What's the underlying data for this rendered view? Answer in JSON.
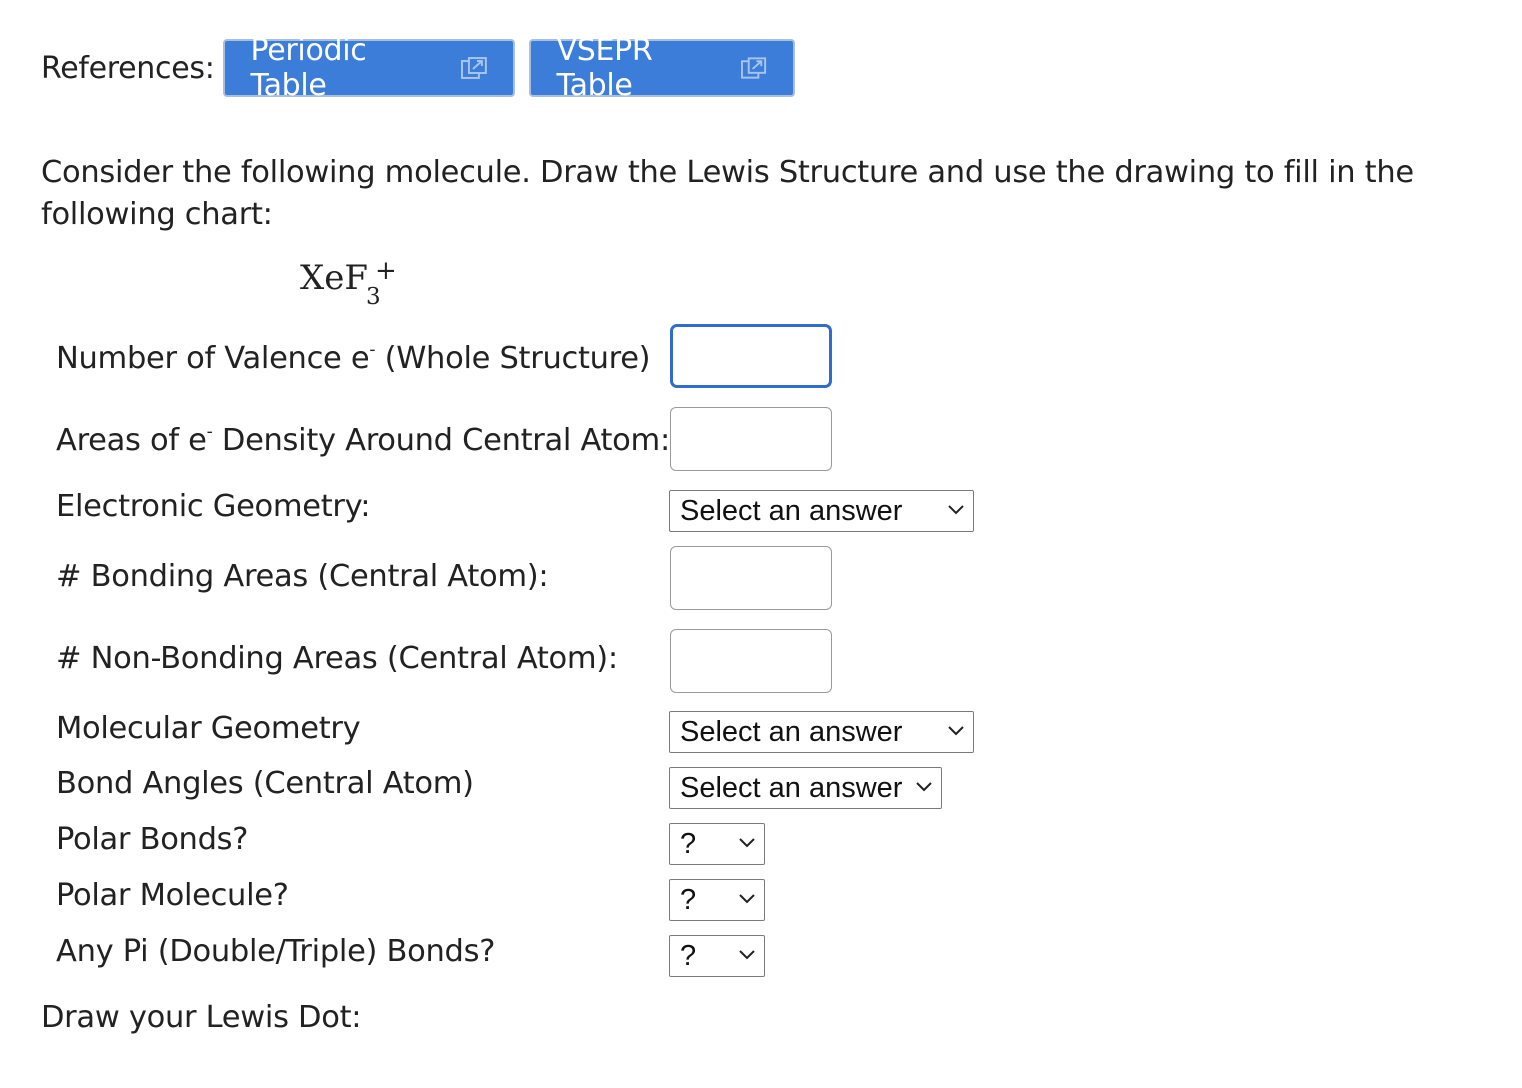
{
  "references": {
    "label": "References:",
    "buttons": [
      {
        "label": "Periodic Table",
        "icon": "external-link-icon"
      },
      {
        "label": "VSEPR Table",
        "icon": "external-link-icon"
      }
    ]
  },
  "question": {
    "text": "Consider the following molecule.  Draw the Lewis Structure and use the drawing to fill in the following chart:"
  },
  "formula": {
    "base": "XeF",
    "subscript": "3",
    "superscript": "+"
  },
  "rows": [
    {
      "label": "Number of Valence e",
      "sup": "-",
      "suffix": " (Whole Structure)",
      "control": "text",
      "value": ""
    },
    {
      "label": "Areas of e",
      "sup": "-",
      "suffix": " Density Around Central Atom:",
      "control": "text",
      "value": ""
    },
    {
      "label": "Electronic Geometry:",
      "control": "select",
      "value": "Select an answer"
    },
    {
      "label": "# Bonding Areas (Central Atom):",
      "control": "text",
      "value": ""
    },
    {
      "label": "# Non-Bonding Areas (Central Atom):",
      "control": "text",
      "value": ""
    },
    {
      "label": "Molecular Geometry",
      "control": "select",
      "value": "Select an answer"
    },
    {
      "label": "Bond Angles (Central Atom)",
      "control": "select",
      "value": "Select an answer"
    },
    {
      "label": "Polar Bonds?",
      "control": "select",
      "value": "?"
    },
    {
      "label": "Polar Molecule?",
      "control": "select",
      "value": "?"
    },
    {
      "label": "Any Pi (Double/Triple) Bonds?",
      "control": "select",
      "value": "?"
    }
  ],
  "draw": {
    "label": "Draw your Lewis Dot:"
  },
  "colors": {
    "button_bg": "#3b7dd8",
    "focus_border": "#2f6bd0"
  }
}
